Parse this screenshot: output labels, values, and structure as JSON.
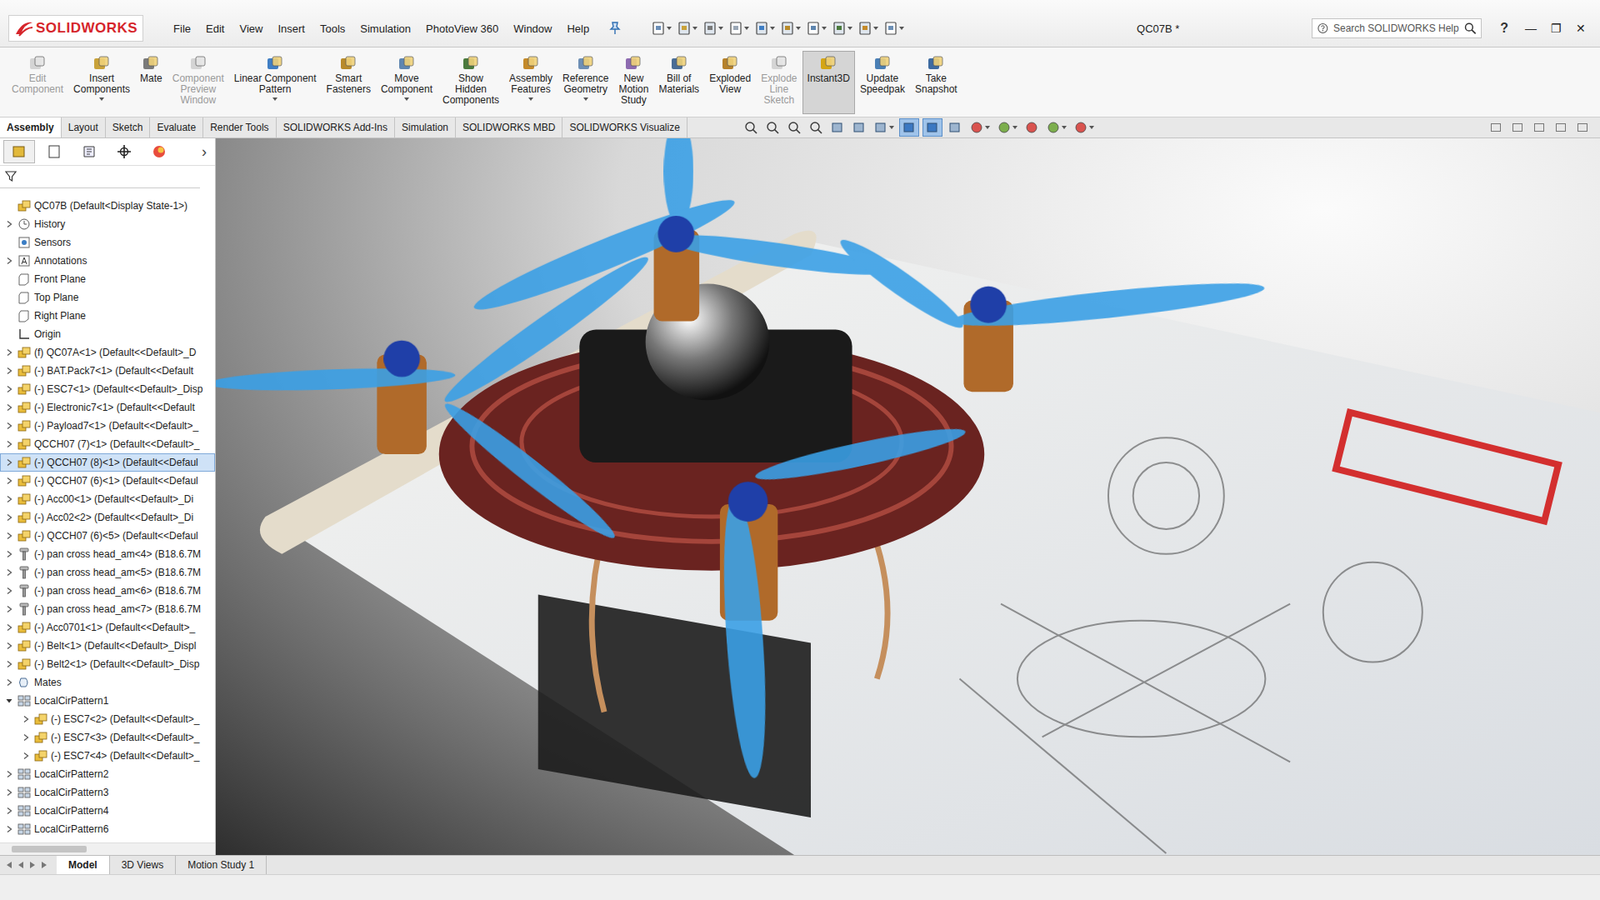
{
  "app": {
    "logo": "SOLIDWORKS",
    "title": "QC07B *",
    "help": "?",
    "window_controls": [
      "—",
      "❐",
      "✕"
    ]
  },
  "menus": [
    "File",
    "Edit",
    "View",
    "Insert",
    "Tools",
    "Simulation",
    "PhotoView 360",
    "Window",
    "Help"
  ],
  "search": {
    "placeholder": "Search SOLIDWORKS Help"
  },
  "ribbon": [
    {
      "lines": [
        "Edit",
        "Component"
      ],
      "disabled": true,
      "selected": false,
      "dropdown": false
    },
    {
      "lines": [
        "Insert",
        "Components"
      ],
      "disabled": false,
      "selected": false,
      "dropdown": true
    },
    {
      "lines": [
        "Mate"
      ],
      "disabled": false,
      "selected": false,
      "dropdown": false
    },
    {
      "lines": [
        "Component",
        "Preview",
        "Window"
      ],
      "disabled": true,
      "selected": false,
      "dropdown": false
    },
    {
      "lines": [
        "Linear Component",
        "Pattern"
      ],
      "disabled": false,
      "selected": false,
      "dropdown": true
    },
    {
      "lines": [
        "Smart",
        "Fasteners"
      ],
      "disabled": false,
      "selected": false,
      "dropdown": false
    },
    {
      "lines": [
        "Move",
        "Component"
      ],
      "disabled": false,
      "selected": false,
      "dropdown": true
    },
    {
      "lines": [
        "Show",
        "Hidden",
        "Components"
      ],
      "disabled": false,
      "selected": false,
      "dropdown": false
    },
    {
      "lines": [
        "Assembly",
        "Features"
      ],
      "disabled": false,
      "selected": false,
      "dropdown": true
    },
    {
      "lines": [
        "Reference",
        "Geometry"
      ],
      "disabled": false,
      "selected": false,
      "dropdown": true
    },
    {
      "lines": [
        "New",
        "Motion",
        "Study"
      ],
      "disabled": false,
      "selected": false,
      "dropdown": false
    },
    {
      "lines": [
        "Bill of",
        "Materials"
      ],
      "disabled": false,
      "selected": false,
      "dropdown": false
    },
    {
      "lines": [
        "Exploded",
        "View"
      ],
      "disabled": false,
      "selected": false,
      "dropdown": false
    },
    {
      "lines": [
        "Explode",
        "Line",
        "Sketch"
      ],
      "disabled": true,
      "selected": false,
      "dropdown": false
    },
    {
      "lines": [
        "Instant3D"
      ],
      "disabled": false,
      "selected": true,
      "dropdown": false
    },
    {
      "lines": [
        "Update",
        "Speedpak"
      ],
      "disabled": false,
      "selected": false,
      "dropdown": false
    },
    {
      "lines": [
        "Take",
        "Snapshot"
      ],
      "disabled": false,
      "selected": false,
      "dropdown": false
    }
  ],
  "tabs": [
    {
      "label": "Assembly",
      "selected": true
    },
    {
      "label": "Layout",
      "selected": false
    },
    {
      "label": "Sketch",
      "selected": false
    },
    {
      "label": "Evaluate",
      "selected": false
    },
    {
      "label": "Render Tools",
      "selected": false
    },
    {
      "label": "SOLIDWORKS Add-Ins",
      "selected": false
    },
    {
      "label": "Simulation",
      "selected": false
    },
    {
      "label": "SOLIDWORKS MBD",
      "selected": false
    },
    {
      "label": "SOLIDWORKS Visualize",
      "selected": false
    }
  ],
  "view_toolbar": [
    {
      "selected": false,
      "dropdown": false
    },
    {
      "selected": false,
      "dropdown": false
    },
    {
      "selected": false,
      "dropdown": false
    },
    {
      "selected": false,
      "dropdown": false
    },
    {
      "selected": false,
      "dropdown": false
    },
    {
      "selected": false,
      "dropdown": false
    },
    {
      "selected": false,
      "dropdown": true
    },
    {
      "selected": true,
      "dropdown": false
    },
    {
      "selected": true,
      "dropdown": false
    },
    {
      "selected": false,
      "dropdown": false
    },
    {
      "selected": false,
      "dropdown": true
    },
    {
      "selected": false,
      "dropdown": true
    },
    {
      "selected": false,
      "dropdown": false
    },
    {
      "selected": false,
      "dropdown": true
    },
    {
      "selected": false,
      "dropdown": true
    }
  ],
  "panel_tabs": [
    {
      "selected": true
    },
    {
      "selected": false
    },
    {
      "selected": false
    },
    {
      "selected": false
    },
    {
      "selected": false
    }
  ],
  "panel_more": "›",
  "tree": [
    {
      "label": "QC07B  (Default<Display State-1>)",
      "kind": "assembly",
      "depth": 0,
      "expandable": false,
      "expanded": false,
      "selected": false
    },
    {
      "label": "History",
      "kind": "history",
      "depth": 0,
      "expandable": true,
      "expanded": false,
      "selected": false
    },
    {
      "label": "Sensors",
      "kind": "sensors",
      "depth": 0,
      "expandable": false,
      "expanded": false,
      "selected": false
    },
    {
      "label": "Annotations",
      "kind": "annotations",
      "depth": 0,
      "expandable": true,
      "expanded": false,
      "selected": false
    },
    {
      "label": "Front Plane",
      "kind": "plane",
      "depth": 0,
      "expandable": false,
      "expanded": false,
      "selected": false
    },
    {
      "label": "Top Plane",
      "kind": "plane",
      "depth": 0,
      "expandable": false,
      "expanded": false,
      "selected": false
    },
    {
      "label": "Right Plane",
      "kind": "plane",
      "depth": 0,
      "expandable": false,
      "expanded": false,
      "selected": false
    },
    {
      "label": "Origin",
      "kind": "origin",
      "depth": 0,
      "expandable": false,
      "expanded": false,
      "selected": false
    },
    {
      "label": "(f) QC07A<1> (Default<<Default>_D",
      "kind": "component",
      "depth": 0,
      "expandable": true,
      "expanded": false,
      "selected": false
    },
    {
      "label": "(-) BAT.Pack7<1> (Default<<Default",
      "kind": "component",
      "depth": 0,
      "expandable": true,
      "expanded": false,
      "selected": false
    },
    {
      "label": "(-) ESC7<1> (Default<<Default>_Disp",
      "kind": "component",
      "depth": 0,
      "expandable": true,
      "expanded": false,
      "selected": false
    },
    {
      "label": "(-) Electronic7<1> (Default<<Default",
      "kind": "component",
      "depth": 0,
      "expandable": true,
      "expanded": false,
      "selected": false
    },
    {
      "label": "(-) Payload7<1> (Default<<Default>_",
      "kind": "component",
      "depth": 0,
      "expandable": true,
      "expanded": false,
      "selected": false
    },
    {
      "label": "QCCH07 (7)<1> (Default<<Default>_",
      "kind": "component",
      "depth": 0,
      "expandable": true,
      "expanded": false,
      "selected": false
    },
    {
      "label": "(-) QCCH07 (8)<1> (Default<<Defaul",
      "kind": "component",
      "depth": 0,
      "expandable": true,
      "expanded": false,
      "selected": true
    },
    {
      "label": "(-) QCCH07 (6)<1> (Default<<Defaul",
      "kind": "component",
      "depth": 0,
      "expandable": true,
      "expanded": false,
      "selected": false
    },
    {
      "label": "(-) Acc00<1> (Default<<Default>_Di",
      "kind": "component",
      "depth": 0,
      "expandable": true,
      "expanded": false,
      "selected": false
    },
    {
      "label": "(-) Acc02<2> (Default<<Default>_Di",
      "kind": "component",
      "depth": 0,
      "expandable": true,
      "expanded": false,
      "selected": false
    },
    {
      "label": "(-) QCCH07 (6)<5> (Default<<Defaul",
      "kind": "component",
      "depth": 0,
      "expandable": true,
      "expanded": false,
      "selected": false
    },
    {
      "label": "(-) pan cross head_am<4> (B18.6.7M",
      "kind": "toolbox",
      "depth": 0,
      "expandable": true,
      "expanded": false,
      "selected": false
    },
    {
      "label": "(-) pan cross head_am<5> (B18.6.7M",
      "kind": "toolbox",
      "depth": 0,
      "expandable": true,
      "expanded": false,
      "selected": false
    },
    {
      "label": "(-) pan cross head_am<6> (B18.6.7M",
      "kind": "toolbox",
      "depth": 0,
      "expandable": true,
      "expanded": false,
      "selected": false
    },
    {
      "label": "(-) pan cross head_am<7> (B18.6.7M",
      "kind": "toolbox",
      "depth": 0,
      "expandable": true,
      "expanded": false,
      "selected": false
    },
    {
      "label": "(-) Acc0701<1> (Default<<Default>_",
      "kind": "component",
      "depth": 0,
      "expandable": true,
      "expanded": false,
      "selected": false
    },
    {
      "label": "(-) Belt<1> (Default<<Default>_Displ",
      "kind": "component",
      "depth": 0,
      "expandable": true,
      "expanded": false,
      "selected": false
    },
    {
      "label": "(-) Belt2<1> (Default<<Default>_Disp",
      "kind": "component",
      "depth": 0,
      "expandable": true,
      "expanded": false,
      "selected": false
    },
    {
      "label": "Mates",
      "kind": "mates",
      "depth": 0,
      "expandable": true,
      "expanded": false,
      "selected": false
    },
    {
      "label": "LocalCirPattern1",
      "kind": "pattern",
      "depth": 0,
      "expandable": true,
      "expanded": true,
      "selected": false
    },
    {
      "label": "(-) ESC7<2> (Default<<Default>_",
      "kind": "component",
      "depth": 1,
      "expandable": true,
      "expanded": false,
      "selected": false
    },
    {
      "label": "(-) ESC7<3> (Default<<Default>_",
      "kind": "component",
      "depth": 1,
      "expandable": true,
      "expanded": false,
      "selected": false
    },
    {
      "label": "(-) ESC7<4> (Default<<Default>_",
      "kind": "component",
      "depth": 1,
      "expandable": true,
      "expanded": false,
      "selected": false
    },
    {
      "label": "LocalCirPattern2",
      "kind": "pattern",
      "depth": 0,
      "expandable": true,
      "expanded": false,
      "selected": false
    },
    {
      "label": "LocalCirPattern3",
      "kind": "pattern",
      "depth": 0,
      "expandable": true,
      "expanded": false,
      "selected": false
    },
    {
      "label": "LocalCirPattern4",
      "kind": "pattern",
      "depth": 0,
      "expandable": true,
      "expanded": false,
      "selected": false
    },
    {
      "label": "LocalCirPattern6",
      "kind": "pattern",
      "depth": 0,
      "expandable": true,
      "expanded": false,
      "selected": false
    }
  ],
  "bottom_tabs": [
    {
      "label": "Model",
      "selected": true
    },
    {
      "label": "3D Views",
      "selected": false
    },
    {
      "label": "Motion Study 1",
      "selected": false
    }
  ]
}
